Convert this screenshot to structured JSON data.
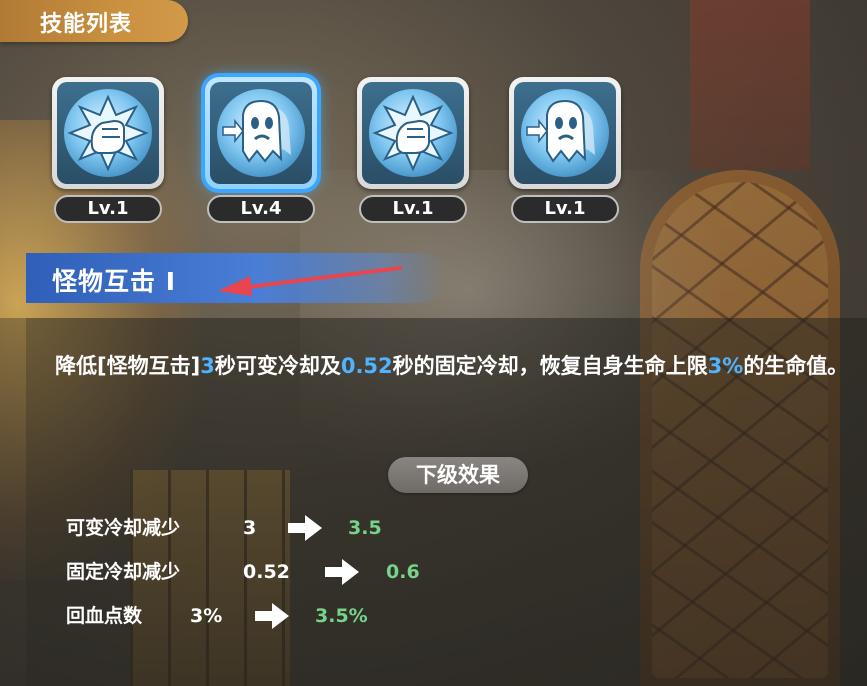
{
  "header": {
    "title": "技能列表"
  },
  "skills": [
    {
      "icon": "fist-burst-icon",
      "level": "Lv.1",
      "selected": false
    },
    {
      "icon": "ghost-dash-icon",
      "level": "Lv.4",
      "selected": true
    },
    {
      "icon": "fist-burst-icon",
      "level": "Lv.1",
      "selected": false
    },
    {
      "icon": "ghost-dash-icon",
      "level": "Lv.1",
      "selected": false
    }
  ],
  "detail": {
    "name": "怪物互击 I",
    "description": {
      "p1": "降低[怪物互击]",
      "v1": "3",
      "p2": "秒可变冷却及",
      "v2": "0.52",
      "p3": "秒的固定冷却，恢复自身生命上限",
      "v3": "3%",
      "p4": "的生命值。"
    },
    "next_level_label": "下级效果",
    "effects": [
      {
        "label": "可变冷却减少",
        "current": "3",
        "next": "3.5"
      },
      {
        "label": "固定冷却减少",
        "current": "0.52",
        "next": "0.6"
      },
      {
        "label": "回血点数",
        "current": "3%",
        "next": "3.5%"
      }
    ]
  },
  "colors": {
    "highlight": "#4fb3ff",
    "next_value": "#76d48a",
    "title_bar": "#c8903f",
    "name_bar": "#3d6fcc",
    "annotation_arrow": "#e8454f"
  }
}
